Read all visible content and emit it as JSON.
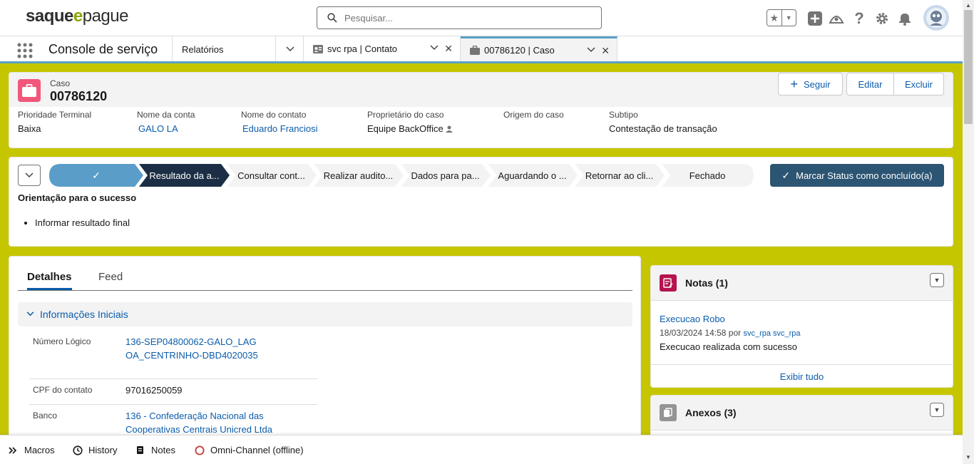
{
  "header": {
    "logo": {
      "part1": "saque",
      "part2": "e",
      "part3": "pague"
    },
    "search_placeholder": "Pesquisar..."
  },
  "nav": {
    "app_name": "Console de serviço",
    "selector_label": "Relatórios",
    "tabs": [
      {
        "label": "svc rpa | Contato",
        "icon": "contact-icon"
      },
      {
        "label": "00786120 | Caso",
        "icon": "case-icon"
      }
    ]
  },
  "highlights": {
    "object_type": "Caso",
    "record_name": "00786120",
    "buttons": {
      "follow": "Seguir",
      "edit": "Editar",
      "delete": "Excluir"
    },
    "fields": [
      {
        "label": "Prioridade Terminal",
        "value": "Baixa"
      },
      {
        "label": "Nome da conta",
        "value": "GALO LA"
      },
      {
        "label": "Nome do contato",
        "value": "Eduardo Franciosi"
      },
      {
        "label": "Proprietário do caso",
        "value": "Equipe BackOffice"
      },
      {
        "label": "Origem do caso",
        "value": ""
      },
      {
        "label": "Subtipo",
        "value": "Contestação de transação"
      }
    ]
  },
  "path": {
    "steps": [
      "",
      "Resultado da a...",
      "Consultar cont...",
      "Realizar audito...",
      "Dados para pa...",
      "Aguardando o ...",
      "Retornar ao cli...",
      "Fechado"
    ],
    "mark_button": "Marcar Status como concluído(a)",
    "guidance_title": "Orientação para o sucesso",
    "guidance_items": [
      "Informar resultado final"
    ]
  },
  "details": {
    "tabs": [
      "Detalhes",
      "Feed"
    ],
    "section_title": "Informações Iniciais",
    "fields": [
      {
        "label": "Número Lógico",
        "value": "136-SEP04800062-GALO_LAGOA_CENTRINHO-DBD4020035"
      },
      {
        "label": "CPF do contato",
        "value": "97016250059"
      },
      {
        "label": "Banco",
        "value": "136 - Confederação Nacional das Cooperativas Centrais Unicred Ltda"
      }
    ]
  },
  "notes": {
    "title": "Notas (1)",
    "item_title": "Execucao Robo",
    "item_meta_date": "18/03/2024 14:58",
    "item_meta_by": "por",
    "item_meta_user": "svc_rpa svc_rpa",
    "item_body": "Execucao realizada com sucesso",
    "view_all": "Exibir tudo"
  },
  "attachments": {
    "title": "Anexos (3)"
  },
  "utility_bar": [
    "Macros",
    "History",
    "Notes",
    "Omni-Channel (offline)"
  ],
  "colors": {
    "brand_green": "#c6c600",
    "path_complete": "#5a9dc8",
    "path_current": "#1b2e45",
    "mark_button": "#2c5473",
    "case_icon": "#f2577b",
    "notes_icon": "#b5134f",
    "link": "#0b5cab"
  }
}
